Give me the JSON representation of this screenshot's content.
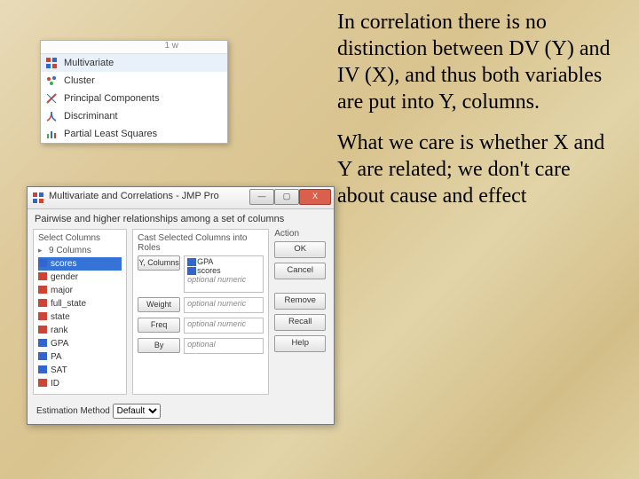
{
  "text": {
    "para1": "In correlation there is no distinction between DV (Y) and IV (X), and thus both variables are put into Y, columns.",
    "para2": "What we care is whether X and Y are related; we don't care about cause and effect"
  },
  "menu": {
    "items": [
      {
        "label": "Multivariate",
        "icon": "grid"
      },
      {
        "label": "Cluster",
        "icon": "cluster"
      },
      {
        "label": "Principal Components",
        "icon": "pc"
      },
      {
        "label": "Discriminant",
        "icon": "disc"
      },
      {
        "label": "Partial Least Squares",
        "icon": "pls"
      }
    ]
  },
  "dialog": {
    "title": "Multivariate and Correlations - JMP Pro",
    "subtitle": "Pairwise and higher relationships among a set of columns",
    "sections": {
      "select": "Select Columns",
      "cast": "Cast Selected Columns into Roles",
      "action": "Action"
    },
    "colcount": "9 Columns",
    "columns": [
      {
        "label": "scores",
        "type": "blue",
        "sel": true
      },
      {
        "label": "gender",
        "type": "red"
      },
      {
        "label": "major",
        "type": "red"
      },
      {
        "label": "full_state",
        "type": "red"
      },
      {
        "label": "state",
        "type": "red"
      },
      {
        "label": "rank",
        "type": "red"
      },
      {
        "label": "GPA",
        "type": "blue"
      },
      {
        "label": "PA",
        "type": "blue"
      },
      {
        "label": "SAT",
        "type": "blue"
      },
      {
        "label": "ID",
        "type": "red"
      }
    ],
    "roles": {
      "y": {
        "btn": "Y, Columns",
        "values": [
          "GPA",
          "scores"
        ],
        "hint": "optional numeric"
      },
      "weight": {
        "btn": "Weight",
        "hint": "optional numeric"
      },
      "freq": {
        "btn": "Freq",
        "hint": "optional numeric"
      },
      "by": {
        "btn": "By",
        "hint": "optional"
      }
    },
    "actions": {
      "ok": "OK",
      "cancel": "Cancel",
      "remove": "Remove",
      "recall": "Recall",
      "help": "Help"
    },
    "est_label": "Estimation Method",
    "est_value": "Default"
  }
}
